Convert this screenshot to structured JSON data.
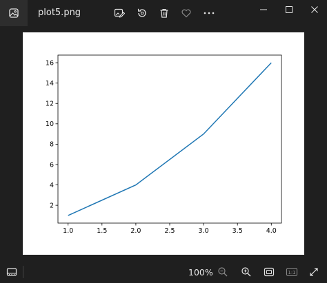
{
  "window": {
    "file_name": "plot5.png"
  },
  "toolbar": {
    "icons": [
      "edit-image-icon",
      "rotate-icon",
      "delete-icon",
      "favorite-heart-icon",
      "more-options-icon"
    ]
  },
  "statusbar": {
    "zoom_level": "100%",
    "icons": [
      "filmstrip-icon",
      "zoom-out-icon",
      "zoom-in-icon",
      "fit-to-window-icon",
      "actual-size-icon",
      "fullscreen-icon"
    ],
    "actual_size_label": "1:1"
  },
  "colors": {
    "background": "#1f1f1f",
    "line": "#1f77b4"
  },
  "chart_data": {
    "type": "line",
    "x": [
      1.0,
      2.0,
      3.0,
      4.0
    ],
    "series": [
      {
        "values": [
          1,
          4,
          9,
          16
        ]
      }
    ],
    "xlim": [
      0.85,
      4.15
    ],
    "ylim": [
      0.25,
      16.75
    ],
    "xticks": [
      "1.0",
      "1.5",
      "2.0",
      "2.5",
      "3.0",
      "3.5",
      "4.0"
    ],
    "yticks": [
      "2",
      "4",
      "6",
      "8",
      "10",
      "12",
      "14",
      "16"
    ],
    "title": "",
    "xlabel": "",
    "ylabel": "",
    "grid": false,
    "legend": false
  }
}
